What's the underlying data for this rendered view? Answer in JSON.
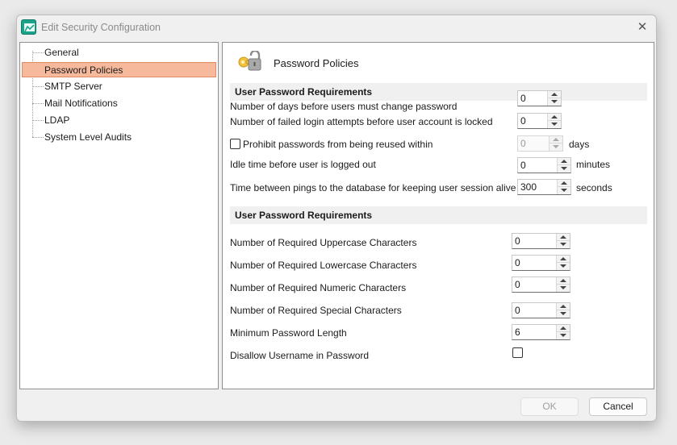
{
  "window": {
    "title": "Edit Security Configuration",
    "close_glyph": "✕"
  },
  "tree": {
    "items": [
      {
        "label": "General"
      },
      {
        "label": "Password Policies"
      },
      {
        "label": "SMTP Server"
      },
      {
        "label": "Mail Notifications"
      },
      {
        "label": "LDAP"
      },
      {
        "label": "System Level Audits"
      }
    ],
    "selected_index": 1
  },
  "page": {
    "title": "Password Policies",
    "icon": "key-lock-icon"
  },
  "section1": {
    "header": "User Password Requirements",
    "days_change": {
      "label": "Number of days before users must change password",
      "value": "0"
    },
    "failed_attempts": {
      "label": "Number of failed login attempts before user account is locked",
      "value": "0"
    },
    "prohibit_reuse": {
      "label": "Prohibit passwords from being reused within",
      "value": "0",
      "unit": "days",
      "checked": false
    },
    "idle_time": {
      "label": "Idle time before user is logged out",
      "value": "0",
      "unit": "minutes"
    },
    "ping_time": {
      "label": "Time between pings to the database for keeping user session alive",
      "value": "300",
      "unit": "seconds"
    }
  },
  "section2": {
    "header": "User Password Requirements",
    "uppercase": {
      "label": "Number of Required Uppercase Characters",
      "value": "0"
    },
    "lowercase": {
      "label": "Number of Required Lowercase Characters",
      "value": "0"
    },
    "numeric": {
      "label": "Number of Required Numeric Characters",
      "value": "0"
    },
    "special": {
      "label": "Number of Required Special Characters",
      "value": "0"
    },
    "min_length": {
      "label": "Minimum Password Length",
      "value": "6"
    },
    "disallow_username": {
      "label": "Disallow Username in Password",
      "checked": false
    }
  },
  "buttons": {
    "ok": "OK",
    "cancel": "Cancel"
  },
  "colors": {
    "selection": "#f6b99c",
    "accent": "#1aa38a"
  }
}
